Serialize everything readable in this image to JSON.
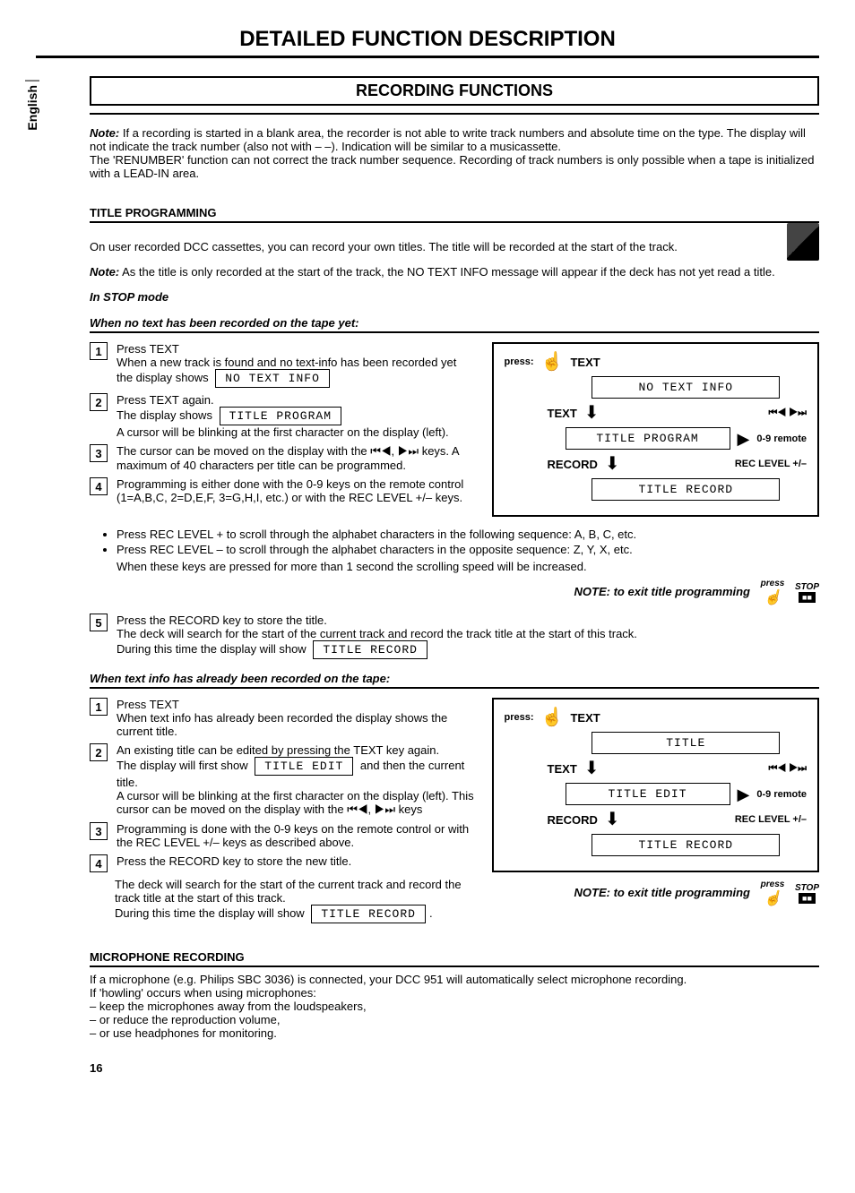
{
  "page_title": "DETAILED FUNCTION DESCRIPTION",
  "lang_tab": "English",
  "section_heading": "RECORDING FUNCTIONS",
  "intro": {
    "note_label": "Note:",
    "note_text": " If a recording is started in a blank area, the recorder is not able to write track numbers and absolute time on the type. The display will not indicate the track number (also not with – –). Indication will be similar to a musicassette.",
    "renumber_text": "The 'RENUMBER' function can not correct the track number sequence. Recording of track numbers is only possible when a tape is initialized with a LEAD-IN area."
  },
  "title_prog": {
    "heading": "TITLE PROGRAMMING",
    "line1": "On user recorded DCC cassettes, you can record your own titles. The title will be recorded at the start of the track.",
    "note_label": "Note:",
    "note_text": " As the title is only recorded at the start of the track, the NO TEXT INFO message will appear if the deck has not yet read a title.",
    "mode": "In STOP mode",
    "sub1": "When no text has been recorded on the tape yet:",
    "steps1": {
      "s1a": "Press TEXT",
      "s1b": "When a new track is found and no text-info has been recorded yet",
      "s1c": "the display shows",
      "d1": "NO TEXT INFO",
      "s2a": "Press TEXT again.",
      "s2b": "The display shows",
      "d2": "TITLE PROGRAM",
      "s2c": "A cursor will be blinking at the first character on the display (left).",
      "s3": "The cursor can be moved on the display with the ⏮◀, ▶⏭ keys. A maximum of 40 characters per title can be programmed.",
      "s4": "Programming is either done with the 0-9 keys on the remote control (1=A,B,C, 2=D,E,F, 3=G,H,I, etc.) or with the REC LEVEL +/– keys.",
      "b1": "Press REC LEVEL + to scroll through the alphabet characters in the following sequence: A, B, C, etc.",
      "b2": "Press REC LEVEL – to scroll through the alphabet characters in the opposite sequence: Z, Y, X, etc.",
      "b3": "When these keys are pressed for more than 1 second the scrolling speed will be increased.",
      "exit": "NOTE: to exit title programming",
      "s5a": "Press the RECORD key to store the title.",
      "s5b": "The deck will search for the start of the current track and record the track title at the start of this track.",
      "s5c": "During this time the display will show",
      "d5": "TITLE RECORD"
    },
    "diag1": {
      "press": "press:",
      "text": "TEXT",
      "d1": "NO TEXT INFO",
      "d2": "TITLE PROGRAM",
      "record": "RECORD",
      "d3": "TITLE RECORD",
      "side_skip": "⏮◀  ▶⏭",
      "side_num": "0-9 remote",
      "side_rec": "REC LEVEL +/–"
    },
    "sub2": "When text info has already been recorded on the tape:",
    "steps2": {
      "s1a": "Press TEXT",
      "s1b": "When text info has already been recorded the display shows the current title.",
      "s2a": "An existing title can be edited by pressing the TEXT key again.",
      "s2b": "The display will first show",
      "d2": "TITLE EDIT",
      "s2c": "and then the current title.",
      "s2d": "A cursor will be blinking at the first character on the display (left). This cursor can be moved on the display with the ⏮◀, ▶⏭ keys",
      "s3": "Programming is done with the 0-9 keys on the remote control or with the REC LEVEL +/– keys as described above.",
      "s4a": "Press the RECORD key to store the new title.",
      "s4b": "The deck will search for the start of the current track and record the track title at the start of this track.",
      "s4c": "During this time the display will show",
      "d4": "TITLE RECORD",
      "exit": "NOTE: to exit title programming"
    },
    "diag2": {
      "press": "press:",
      "text": "TEXT",
      "d1": "TITLE",
      "d2": "TITLE EDIT",
      "record": "RECORD",
      "d3": "TITLE RECORD",
      "side_skip": "⏮◀  ▶⏭",
      "side_num": "0-9 remote",
      "side_rec": "REC LEVEL +/–"
    },
    "stop_press": "press",
    "stop_label": "STOP"
  },
  "mic": {
    "heading": "MICROPHONE RECORDING",
    "line1": "If a microphone (e.g. Philips SBC 3036) is connected, your DCC 951 will automatically select microphone recording.",
    "line2": "If 'howling' occurs when using microphones:",
    "b1": "– keep the microphones away from the loudspeakers,",
    "b2": "– or reduce the reproduction volume,",
    "b3": "– or use headphones for monitoring."
  },
  "page_number": "16"
}
